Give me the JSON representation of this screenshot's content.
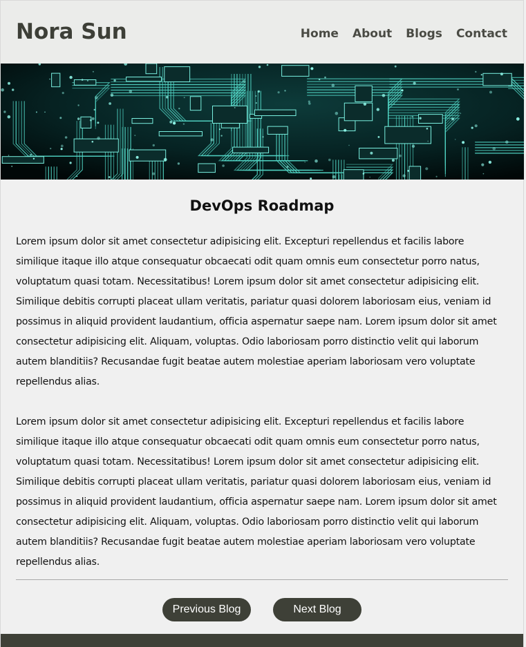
{
  "site": {
    "brand": "Nora Sun"
  },
  "nav": {
    "items": [
      {
        "label": "Home"
      },
      {
        "label": "About"
      },
      {
        "label": "Blogs"
      },
      {
        "label": "Contact"
      }
    ]
  },
  "article": {
    "title": "DevOps Roadmap",
    "paragraphs": [
      "Lorem ipsum dolor sit amet consectetur adipisicing elit. Excepturi repellendus et facilis labore similique itaque illo atque consequatur obcaecati odit quam omnis eum consectetur porro natus, voluptatum quasi totam. Necessitatibus! Lorem ipsum dolor sit amet consectetur adipisicing elit. Similique debitis corrupti placeat ullam veritatis, pariatur quasi dolorem laboriosam eius, veniam id possimus in aliquid provident laudantium, officia aspernatur saepe nam. Lorem ipsum dolor sit amet consectetur adipisicing elit. Aliquam, voluptas. Odio laboriosam porro distinctio velit qui laborum autem blanditiis? Recusandae fugit beatae autem molestiae aperiam laboriosam vero voluptate repellendus alias.",
      "Lorem ipsum dolor sit amet consectetur adipisicing elit. Excepturi repellendus et facilis labore similique itaque illo atque consequatur obcaecati odit quam omnis eum consectetur porro natus, voluptatum quasi totam. Necessitatibus! Lorem ipsum dolor sit amet consectetur adipisicing elit. Similique debitis corrupti placeat ullam veritatis, pariatur quasi dolorem laboriosam eius, veniam id possimus in aliquid provident laudantium, officia aspernatur saepe nam. Lorem ipsum dolor sit amet consectetur adipisicing elit. Aliquam, voluptas. Odio laboriosam porro distinctio velit qui laborum autem blanditiis? Recusandae fugit beatae autem molestiae aperiam laboriosam vero voluptate repellendus alias."
    ]
  },
  "pager": {
    "previous_label": "Previous Blog",
    "next_label": "Next Blog"
  },
  "theme": {
    "accent": "#3e4037",
    "header_bg": "#ebecea",
    "page_bg": "#f0f0f0"
  },
  "hero": {
    "icon": "circuit-board-image"
  }
}
